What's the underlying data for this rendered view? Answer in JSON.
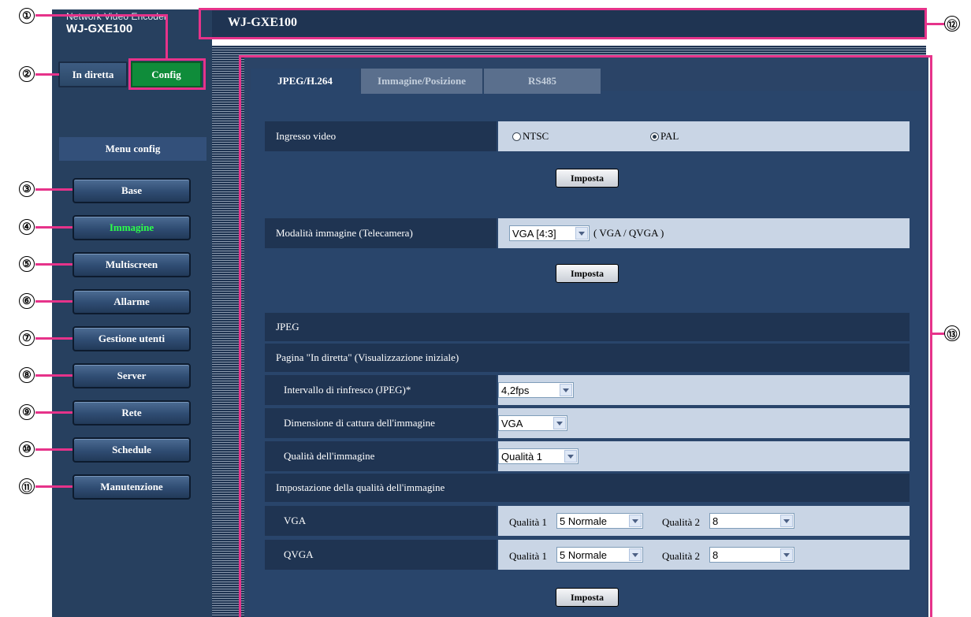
{
  "brand": {
    "subtitle": "Network Video Encoder",
    "model": "WJ-GXE100"
  },
  "header": {
    "title": "WJ-GXE100"
  },
  "mode_tabs": {
    "live": "In diretta",
    "config": "Config"
  },
  "menu": {
    "title": "Menu config",
    "items": [
      {
        "label": "Base",
        "callout": "③"
      },
      {
        "label": "Immagine",
        "callout": "④",
        "active": true
      },
      {
        "label": "Multiscreen",
        "callout": "⑤"
      },
      {
        "label": "Allarme",
        "callout": "⑥"
      },
      {
        "label": "Gestione utenti",
        "callout": "⑦"
      },
      {
        "label": "Server",
        "callout": "⑧"
      },
      {
        "label": "Rete",
        "callout": "⑨"
      },
      {
        "label": "Schedule",
        "callout": "⑩"
      },
      {
        "label": "Manutenzione",
        "callout": "⑪"
      }
    ]
  },
  "page_tabs": [
    "JPEG/H.264",
    "Immagine/Posizione",
    "RS485"
  ],
  "video_input": {
    "label": "Ingresso video",
    "options": [
      "NTSC",
      "PAL"
    ],
    "selected": "PAL"
  },
  "image_mode": {
    "label": "Modalità immagine (Telecamera)",
    "value": "VGA [4:3]",
    "note": "( VGA / QVGA )"
  },
  "set_button": "Imposta",
  "jpeg": {
    "section": "JPEG",
    "live_section": "Pagina \"In diretta\" (Visualizzazione iniziale)",
    "refresh": {
      "label": "Intervallo di rinfresco (JPEG)*",
      "value": "4,2fps"
    },
    "capture_size": {
      "label": "Dimensione di cattura dell'immagine",
      "value": "VGA"
    },
    "quality": {
      "label": "Qualità dell'immagine",
      "value": "Qualità 1"
    },
    "quality_section": "Impostazione della qualità dell'immagine",
    "rows": [
      {
        "label": "VGA",
        "q1_label": "Qualità 1",
        "q1": "5 Normale",
        "q2_label": "Qualità 2",
        "q2": "8"
      },
      {
        "label": "QVGA",
        "q1_label": "Qualità 1",
        "q1": "5 Normale",
        "q2_label": "Qualità 2",
        "q2": "8"
      }
    ]
  },
  "callouts": {
    "c1": "①",
    "c2": "②",
    "c12": "⑫",
    "c13": "⑬"
  },
  "colors": {
    "accent_pink": "#e6338a",
    "navy": "#1f3452",
    "active_green": "#2cff4a",
    "config_green": "#0f8c3a"
  }
}
